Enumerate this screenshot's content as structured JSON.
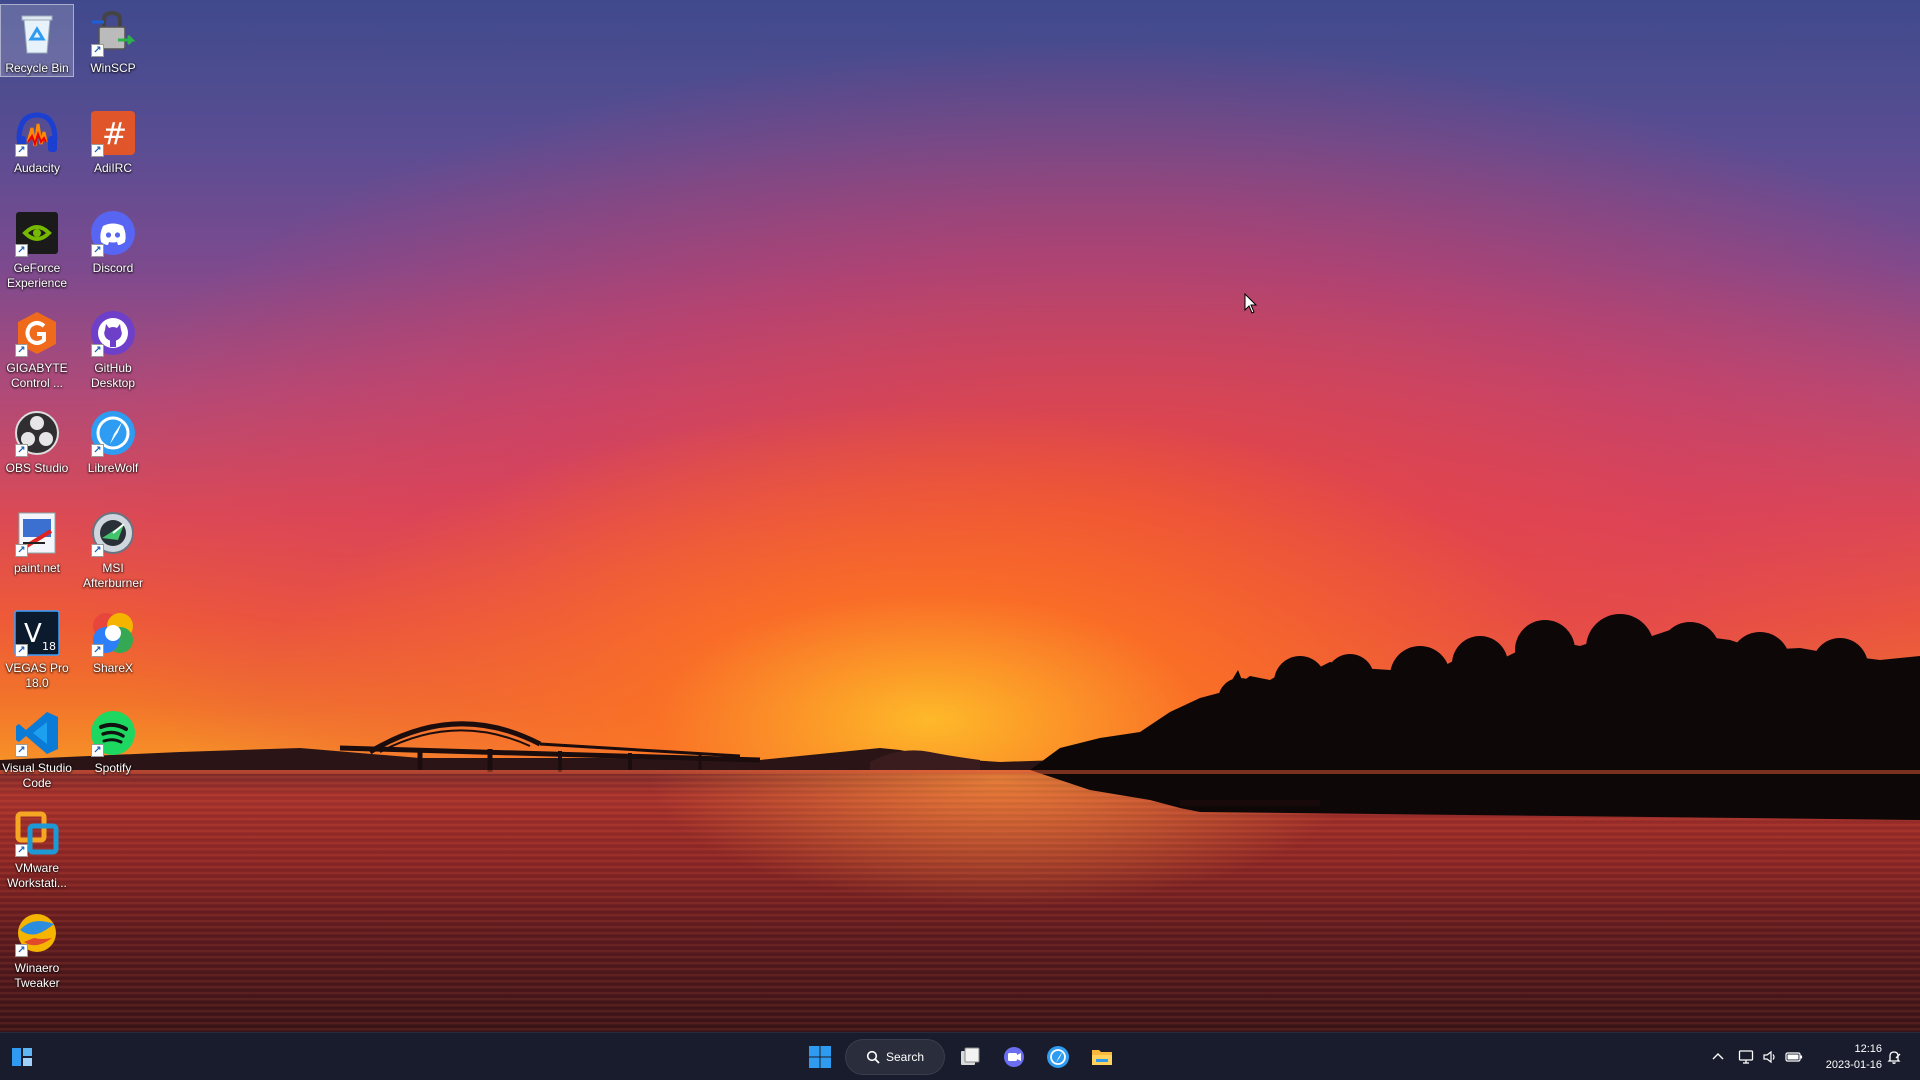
{
  "desktop": {
    "icons": [
      {
        "id": "recycle-bin",
        "label": "Recycle Bin"
      },
      {
        "id": "winscp",
        "label": "WinSCP"
      },
      {
        "id": "audacity",
        "label": "Audacity"
      },
      {
        "id": "adiirc",
        "label": "AdiIRC"
      },
      {
        "id": "geforce",
        "label": "GeForce Experience"
      },
      {
        "id": "discord",
        "label": "Discord"
      },
      {
        "id": "gigabyte",
        "label": "GIGABYTE Control ..."
      },
      {
        "id": "github",
        "label": "GitHub Desktop"
      },
      {
        "id": "obs",
        "label": "OBS Studio"
      },
      {
        "id": "librewolf",
        "label": "LibreWolf"
      },
      {
        "id": "paintnet",
        "label": "paint.net"
      },
      {
        "id": "msi",
        "label": "MSI Afterburner"
      },
      {
        "id": "vegas",
        "label": "VEGAS Pro 18.0"
      },
      {
        "id": "sharex",
        "label": "ShareX"
      },
      {
        "id": "vscode",
        "label": "Visual Studio Code"
      },
      {
        "id": "spotify",
        "label": "Spotify"
      },
      {
        "id": "vmware",
        "label": "VMware Workstati..."
      },
      {
        "id": "winaero",
        "label": "Winaero Tweaker"
      }
    ],
    "selected_icon": "Recycle Bin",
    "shortcut_arrow_glyph": "↗",
    "vegas_glyph": "V",
    "vegas_version": "18",
    "adiirc_glyph": "#"
  },
  "taskbar": {
    "search_label": "Search",
    "clock_time": "12:16",
    "clock_date": "2023-01-16"
  },
  "colors": {
    "taskbar_bg": "#161a26",
    "windows_blue": "#2f9bf0",
    "discord": "#5865f2",
    "spotify": "#1ed760",
    "github": "#6e40c9"
  }
}
